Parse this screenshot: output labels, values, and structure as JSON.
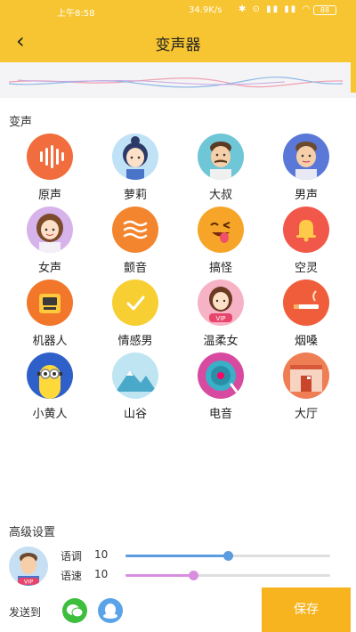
{
  "status_bar": {
    "time": "上午8:58",
    "network_speed": "34.9K/s",
    "battery": "88"
  },
  "header": {
    "title": "变声器"
  },
  "section_voice": "变声",
  "effects": [
    {
      "label": "原声",
      "icon": "waveform-icon"
    },
    {
      "label": "萝莉",
      "icon": "girl-avatar-icon"
    },
    {
      "label": "大叔",
      "icon": "uncle-avatar-icon"
    },
    {
      "label": "男声",
      "icon": "man-avatar-icon"
    },
    {
      "label": "女声",
      "icon": "woman-avatar-icon"
    },
    {
      "label": "颤音",
      "icon": "tremolo-waves-icon"
    },
    {
      "label": "搞怪",
      "icon": "funny-face-icon"
    },
    {
      "label": "空灵",
      "icon": "bell-icon"
    },
    {
      "label": "机器人",
      "icon": "robot-icon"
    },
    {
      "label": "情感男",
      "icon": "check-icon"
    },
    {
      "label": "温柔女",
      "icon": "gentle-woman-vip-icon",
      "badge": "VIP"
    },
    {
      "label": "烟嗓",
      "icon": "cigarette-icon"
    },
    {
      "label": "小黄人",
      "icon": "minion-icon"
    },
    {
      "label": "山谷",
      "icon": "mountain-icon"
    },
    {
      "label": "电音",
      "icon": "vinyl-disc-icon"
    },
    {
      "label": "大厅",
      "icon": "hall-icon"
    }
  ],
  "advanced": {
    "title": "高级设置",
    "avatar_badge": "VIP",
    "pitch": {
      "label": "语调",
      "value": "10",
      "level": 0.5
    },
    "speed": {
      "label": "语速",
      "value": "10",
      "level": 0.33
    }
  },
  "send_to": "发送到",
  "share_targets": [
    "wechat-icon",
    "qq-icon"
  ],
  "save_label": "保存",
  "colors": {
    "accent": "#f7c531",
    "save": "#f7b41f",
    "pitch_slider": "#5b9be0",
    "speed_slider": "#d98ee0"
  }
}
